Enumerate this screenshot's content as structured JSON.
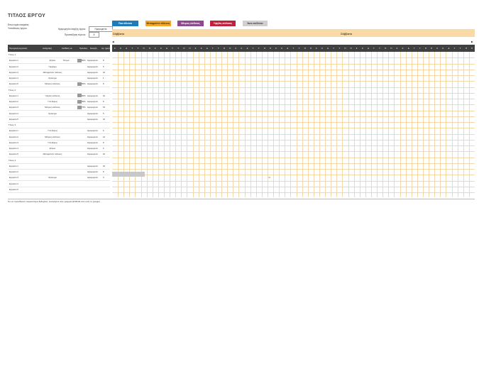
{
  "header": {
    "title": "ΤΙΤΛΟΣ ΕΡΓΟΥ",
    "company": "Επωνυμία εταιρείας",
    "manager": "Υπεύθυνος έργου",
    "start_label": "Ημερομηνία έναρξης έργου:",
    "start_value": "Ημερομηνία",
    "period_label": "Προσαύξηση εύρους:",
    "period_value": "6"
  },
  "legend": [
    {
      "label": "Ποσ.όδευσα",
      "color": "#1f7bb6",
      "text": "#ffffff"
    },
    {
      "label": "Μεταφράστε πλάνους",
      "color": "#f5a623",
      "text": "#333333"
    },
    {
      "label": "Μέτριος κίνδυνος",
      "color": "#8e4b8b",
      "text": "#ffffff"
    },
    {
      "label": "Υψηλός κίνδυνος",
      "color": "#c0203c",
      "text": "#ffffff"
    },
    {
      "label": "Άνευ κινδύνου",
      "color": "#cfcfcf",
      "text": "#333333"
    }
  ],
  "months": [
    "Σάββατο",
    "Σάββατο"
  ],
  "columns": [
    "Περιγραφή εργασίας",
    "Ανάγραφή",
    "Ανάθεση σε",
    "Πρόοδος",
    "Έναρξη",
    "Αρ. ημερών"
  ],
  "rows": [
    {
      "type": "group",
      "name": "Τίτλος 1"
    },
    {
      "type": "task",
      "name": "Εργασία 1",
      "cat": "Ετήσιο",
      "owner": "Όνομα",
      "progress": "50%",
      "start": "Ημερομηνία",
      "days": "8"
    },
    {
      "type": "task",
      "name": "Εργασία 2",
      "cat": "Υψηλόμο",
      "owner": "",
      "progress": "",
      "start": "Ημερομηνία",
      "days": "5"
    },
    {
      "type": "task",
      "name": "Εργασία 3",
      "cat": "Μεταφράστε πλάνους",
      "owner": "",
      "progress": "",
      "start": "Ημερομηνία",
      "days": "10"
    },
    {
      "type": "task",
      "name": "Εργασία 4",
      "cat": "Ορόσημο",
      "owner": "",
      "progress": "",
      "start": "Ημερομηνία",
      "days": "1"
    },
    {
      "type": "task",
      "name": "Εργασία 5",
      "cat": "Μέτριος κίνδυνος",
      "owner": "",
      "progress": "50%",
      "start": "Ημερομηνία",
      "days": "8"
    },
    {
      "type": "group",
      "name": "Τίτλος 2"
    },
    {
      "type": "task",
      "name": "Εργασία 1",
      "cat": "Υψηλός κίνδυνος",
      "owner": "",
      "progress": "50%",
      "start": "Ημερομηνία",
      "days": "10"
    },
    {
      "type": "task",
      "name": "Εργασία 2",
      "cat": "Υπό Εύρος",
      "owner": "",
      "progress": "50%",
      "start": "Ημερομηνία",
      "days": "8"
    },
    {
      "type": "task",
      "name": "Εργασία 3",
      "cat": "Μέτριος κίνδυνος",
      "owner": "",
      "progress": "75%",
      "start": "Ημερομηνία",
      "days": "15"
    },
    {
      "type": "task",
      "name": "Εργασία 4",
      "cat": "Ορόσημο",
      "owner": "",
      "progress": "",
      "start": "Ημερομηνία",
      "days": "5"
    },
    {
      "type": "task",
      "name": "Εργασία 5",
      "cat": "",
      "owner": "",
      "progress": "",
      "start": "Ημερομηνία",
      "days": "10"
    },
    {
      "type": "group",
      "name": "Τίτλος 3"
    },
    {
      "type": "task",
      "name": "Εργασία 1",
      "cat": "Υπό Εύρος",
      "owner": "",
      "progress": "",
      "start": "Ημερομηνία",
      "days": "6"
    },
    {
      "type": "task",
      "name": "Εργασία 2",
      "cat": "Μέτριος κίνδυνος",
      "owner": "",
      "progress": "",
      "start": "Ημερομηνία",
      "days": "14"
    },
    {
      "type": "task",
      "name": "Εργασία 3",
      "cat": "Υπό Εύρος",
      "owner": "",
      "progress": "",
      "start": "Ημερομηνία",
      "days": "8"
    },
    {
      "type": "task",
      "name": "Εργασία 4",
      "cat": "Ετήσιο",
      "owner": "",
      "progress": "",
      "start": "Ημερομηνία",
      "days": "6"
    },
    {
      "type": "task",
      "name": "Εργασία 5",
      "cat": "Μεταφράστε πλάνους",
      "owner": "",
      "progress": "",
      "start": "Ημερομηνία",
      "days": "10"
    },
    {
      "type": "group",
      "name": "Τίτλος 4"
    },
    {
      "type": "task",
      "name": "Εργασία 1",
      "cat": "",
      "owner": "",
      "progress": "",
      "start": "Ημερομηνία",
      "days": "10"
    },
    {
      "type": "task",
      "name": "Εργασία 2",
      "cat": "",
      "owner": "",
      "progress": "",
      "start": "Ημερομηνία",
      "days": "8"
    },
    {
      "type": "task",
      "name": "Εργασία 3",
      "cat": "Ορόσημο",
      "owner": "",
      "progress": "",
      "start": "Ημερομηνία",
      "days": "0"
    },
    {
      "type": "task",
      "name": "Εργασία 4",
      "cat": "",
      "owner": "",
      "progress": "",
      "start": "",
      "days": ""
    },
    {
      "type": "task",
      "name": "Εργασία 5",
      "cat": "",
      "owner": "",
      "progress": "",
      "start": "",
      "days": ""
    }
  ],
  "day_letters": [
    "Σ",
    "Κ",
    "Δ",
    "Τ",
    "Τ",
    "Π",
    "Π",
    "Σ",
    "Κ",
    "Δ",
    "Τ",
    "Τ",
    "Π",
    "Π",
    "Σ",
    "Κ",
    "Δ",
    "Τ",
    "Τ",
    "Π",
    "Π",
    "Σ",
    "Κ",
    "Δ",
    "Τ",
    "Τ",
    "Π",
    "Π",
    "Σ",
    "Κ",
    "Δ",
    "Τ",
    "Τ",
    "Π",
    "Π",
    "Σ",
    "Κ",
    "Δ",
    "Τ",
    "Τ",
    "Π",
    "Π",
    "Σ",
    "Κ",
    "Δ",
    "Τ",
    "Τ",
    "Π",
    "Π",
    "Σ",
    "Κ",
    "Δ",
    "Τ",
    "Τ",
    "Π",
    "Π",
    "Σ",
    "Κ",
    "Δ",
    "Τ",
    "Τ",
    "Π",
    "Π"
  ],
  "milestone_marker": "30",
  "footer": "Για να προσθέσετε περισσότερα δεδομένα, εισαγάγετε νέες γραμμές ΕΠΑΝΩ από αυτή τη γραμμή"
}
